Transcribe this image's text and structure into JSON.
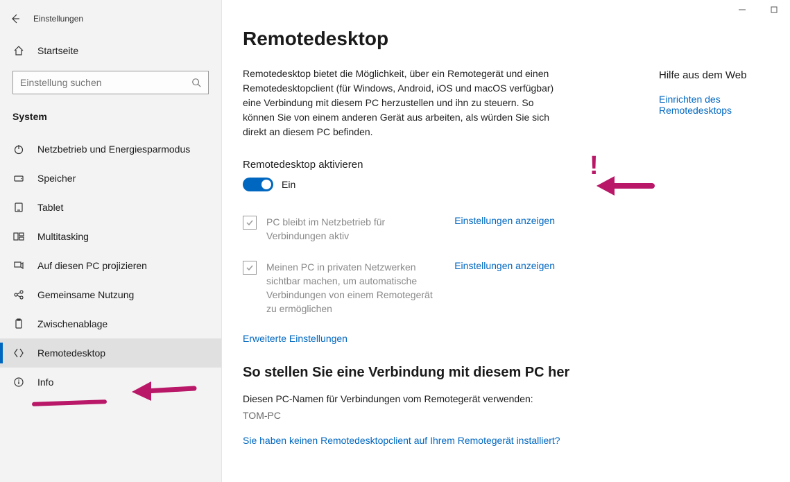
{
  "window": {
    "app_title": "Einstellungen"
  },
  "sidebar": {
    "home": "Startseite",
    "search_placeholder": "Einstellung suchen",
    "section": "System",
    "items": [
      {
        "label": "Netzbetrieb und Energiesparmodus"
      },
      {
        "label": "Speicher"
      },
      {
        "label": "Tablet"
      },
      {
        "label": "Multitasking"
      },
      {
        "label": "Auf diesen PC projizieren"
      },
      {
        "label": "Gemeinsame Nutzung"
      },
      {
        "label": "Zwischenablage"
      },
      {
        "label": "Remotedesktop"
      },
      {
        "label": "Info"
      }
    ]
  },
  "content": {
    "title": "Remotedesktop",
    "description": "Remotedesktop bietet die Möglichkeit, über ein Remotegerät und einen Remotedesktopclient (für Windows, Android, iOS und macOS verfügbar) eine Verbindung mit diesem PC herzustellen und ihn zu steuern. So können Sie von einem anderen Gerät aus arbeiten, als würden Sie sich direkt an diesem PC befinden.",
    "enable_label": "Remotedesktop aktivieren",
    "toggle_state": "Ein",
    "check1_text": "PC bleibt im Netzbetrieb für Verbindungen aktiv",
    "check1_action": "Einstellungen anzeigen",
    "check2_text": "Meinen PC in privaten Netzwerken sichtbar machen, um automatische Verbindungen von einem Remotegerät zu ermöglichen",
    "check2_action": "Einstellungen anzeigen",
    "advanced": "Erweiterte Einstellungen",
    "connect_heading": "So stellen Sie eine Verbindung mit diesem PC her",
    "pcname_label": "Diesen PC-Namen für Verbindungen vom Remotegerät verwenden:",
    "pcname": "TOM-PC",
    "noclient": "Sie haben keinen Remotedesktopclient auf Ihrem Remotegerät installiert?"
  },
  "help": {
    "title": "Hilfe aus dem Web",
    "link1": "Einrichten des Remotedesktops"
  }
}
